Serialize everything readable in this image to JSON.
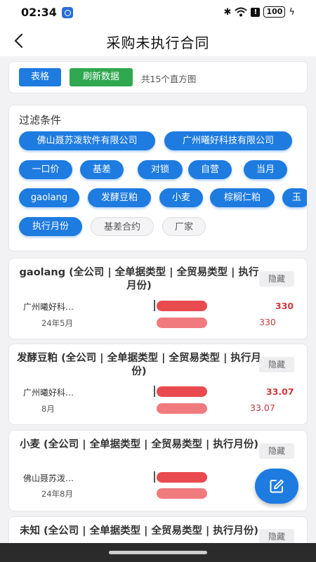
{
  "status": {
    "time": "02:34",
    "battery": "100"
  },
  "header": {
    "title": "采购未执行合同"
  },
  "toolbar": {
    "table_label": "表格",
    "refresh_label": "刷新数据",
    "count_text": "共15个直方图"
  },
  "filter": {
    "title": "过滤条件",
    "chips": [
      {
        "label": "佛山聂苏泼软件有限公司",
        "active": true
      },
      {
        "label": "广州曦好科技有限公司",
        "active": true
      },
      {
        "label": "一口价",
        "active": true
      },
      {
        "label": "基差",
        "active": true
      },
      {
        "label": "对锁",
        "active": true
      },
      {
        "label": "自营",
        "active": true
      },
      {
        "label": "当月",
        "active": true
      },
      {
        "label": "gaolang",
        "active": true
      },
      {
        "label": "发酵豆粕",
        "active": true
      },
      {
        "label": "小麦",
        "active": true
      },
      {
        "label": "棕榈仁粕",
        "active": true
      },
      {
        "label": "玉",
        "active": true
      },
      {
        "label": "执行月份",
        "active": true
      },
      {
        "label": "基差合约",
        "active": false
      },
      {
        "label": "厂家",
        "active": false
      }
    ]
  },
  "charts": [
    {
      "title": "gaolang (全公司 | 全单据类型 | 全贸易类型 | 执行月份)",
      "hide_label": "隐藏",
      "row_label": "广州曦好科…",
      "row_sub": "24年5月",
      "value_main": "330",
      "value_sub": "330"
    },
    {
      "title": "发酵豆粕 (全公司 | 全单据类型 | 全贸易类型 | 执行月份)",
      "hide_label": "隐藏",
      "row_label": "广州曦好科…",
      "row_sub": "8月",
      "value_main": "33.07",
      "value_sub": "33.07"
    },
    {
      "title": "小麦 (全公司 | 全单据类型 | 全贸易类型 | 执行月份)",
      "hide_label": "隐藏",
      "row_label": "佛山聂苏泼…",
      "row_sub": "24年8月",
      "value_main": "",
      "value_sub": ""
    },
    {
      "title": "未知 (全公司 | 全单据类型 | 全贸易类型 | 执行月份)",
      "hide_label": "隐藏"
    }
  ],
  "colors": {
    "primary": "#1e7be0",
    "refresh": "#2fa84f",
    "bar_dark": "#e84a4f",
    "bar_light": "#f07a7e"
  },
  "icons": {
    "back": "chevron-left-icon",
    "fab": "edit-icon"
  }
}
